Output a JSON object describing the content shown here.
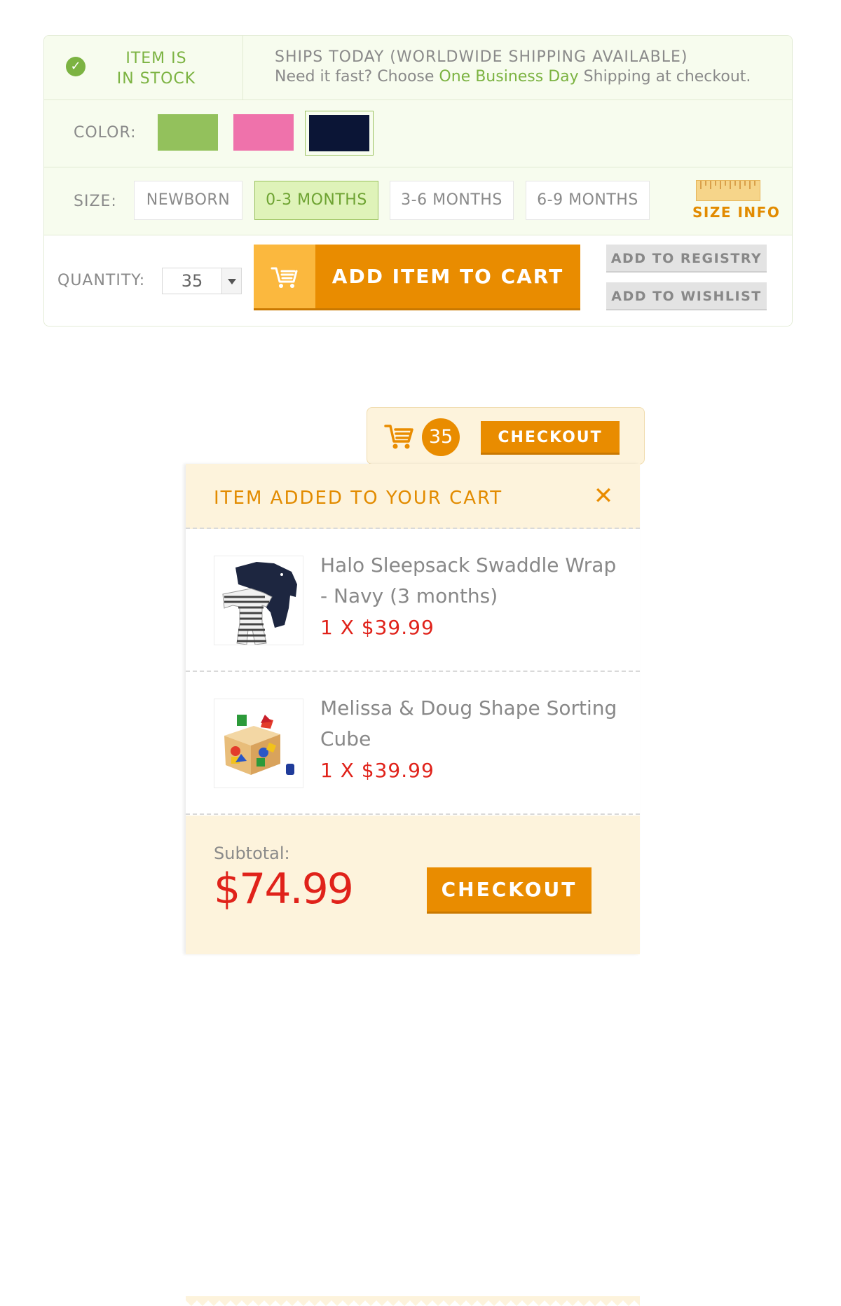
{
  "stock": {
    "status": "ITEM IS IN STOCK",
    "status_line1": "ITEM IS",
    "status_line2": "IN STOCK",
    "ships": "SHIPS TODAY (WORLDWIDE SHIPPING AVAILABLE)",
    "fast_prefix": "Need it fast? Choose ",
    "fast_highlight": "One Business Day",
    "fast_suffix": " Shipping at checkout."
  },
  "color": {
    "label": "COLOR:",
    "swatches": [
      {
        "name": "green",
        "hex": "#93c15c"
      },
      {
        "name": "pink",
        "hex": "#ef72ab"
      },
      {
        "name": "navy",
        "hex": "#0b1536",
        "selected": true
      }
    ]
  },
  "size": {
    "label": "SIZE:",
    "options": [
      "NEWBORN",
      "0-3 MONTHS",
      "3-6 MONTHS",
      "6-9 MONTHS"
    ],
    "selected": "0-3 MONTHS",
    "info_label": "SIZE INFO"
  },
  "quantity": {
    "label": "QUANTITY:",
    "value": "35"
  },
  "actions": {
    "add_to_cart": "ADD ITEM TO CART",
    "add_to_registry": "ADD TO REGISTRY",
    "add_to_wishlist": "ADD TO WISHLIST"
  },
  "mini_cart": {
    "count": "35",
    "checkout": "CHECKOUT"
  },
  "dropdown": {
    "title": "ITEM ADDED TO YOUR CART",
    "items": [
      {
        "name": "Halo Sleepsack Swaddle Wrap - Navy (3 months)",
        "price": "1 X $39.99"
      },
      {
        "name": "Melissa & Doug Shape Sorting Cube",
        "price": "1 X $39.99"
      }
    ],
    "subtotal_label": "Subtotal:",
    "subtotal_value": "$74.99",
    "checkout": "CHECKOUT"
  },
  "colors": {
    "accent_orange": "#e98c00",
    "accent_green": "#7cb342",
    "price_red": "#e0221a"
  }
}
